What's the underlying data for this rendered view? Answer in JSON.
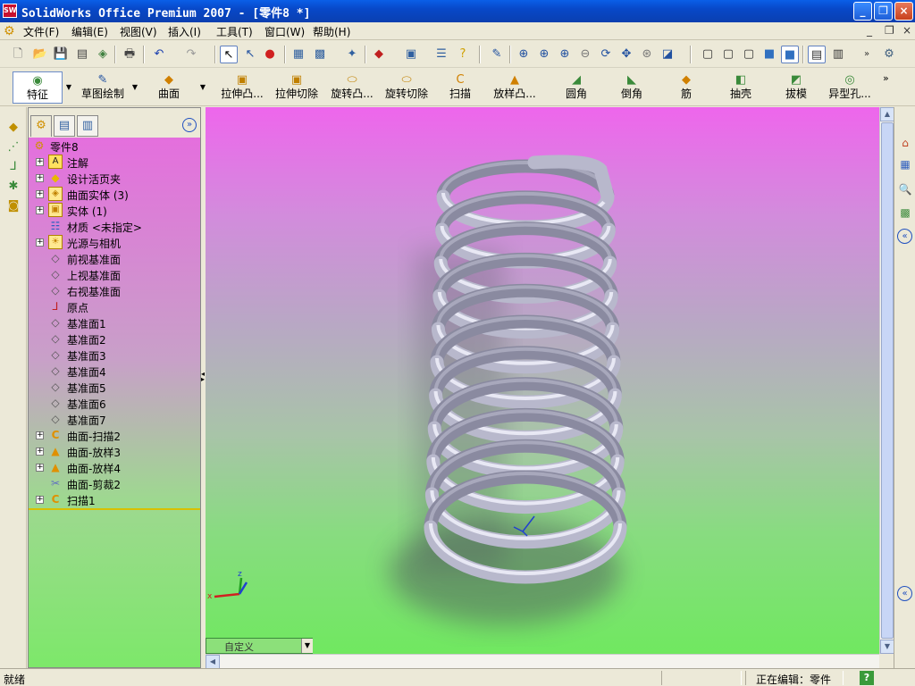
{
  "window": {
    "title": "SolidWorks Office Premium 2007 - [零件8 *]",
    "logo_text": "SW"
  },
  "menu": {
    "items": [
      "文件(F)",
      "编辑(E)",
      "视图(V)",
      "插入(I)",
      "工具(T)",
      "窗口(W)",
      "帮助(H)"
    ],
    "doc_controls": [
      "_",
      "❐",
      "×"
    ]
  },
  "feature_toolbar": {
    "buttons": [
      "特征",
      "草图绘制",
      "曲面",
      "拉伸凸...",
      "拉伸切除",
      "旋转凸...",
      "旋转切除",
      "扫描",
      "放样凸...",
      "圆角",
      "倒角",
      "筋",
      "抽壳",
      "拔模",
      "异型孔..."
    ]
  },
  "feature_tree": {
    "root": "零件8",
    "items": [
      {
        "label": "注解",
        "icon": "annotation-icon",
        "expandable": true
      },
      {
        "label": "设计活页夹",
        "icon": "design-binder-icon",
        "expandable": true
      },
      {
        "label": "曲面实体 (3)",
        "icon": "surface-bodies-icon",
        "expandable": true
      },
      {
        "label": "实体 (1)",
        "icon": "solid-bodies-icon",
        "expandable": true
      },
      {
        "label": "材质 <未指定>",
        "icon": "material-icon",
        "expandable": false
      },
      {
        "label": "光源与相机",
        "icon": "lights-cameras-icon",
        "expandable": true
      },
      {
        "label": "前视基准面",
        "icon": "plane-icon",
        "expandable": false
      },
      {
        "label": "上视基准面",
        "icon": "plane-icon",
        "expandable": false
      },
      {
        "label": "右视基准面",
        "icon": "plane-icon",
        "expandable": false
      },
      {
        "label": "原点",
        "icon": "origin-icon",
        "expandable": false
      },
      {
        "label": "基准面1",
        "icon": "plane-icon",
        "expandable": false
      },
      {
        "label": "基准面2",
        "icon": "plane-icon",
        "expandable": false
      },
      {
        "label": "基准面3",
        "icon": "plane-icon",
        "expandable": false
      },
      {
        "label": "基准面4",
        "icon": "plane-icon",
        "expandable": false
      },
      {
        "label": "基准面5",
        "icon": "plane-icon",
        "expandable": false
      },
      {
        "label": "基准面6",
        "icon": "plane-icon",
        "expandable": false
      },
      {
        "label": "基准面7",
        "icon": "plane-icon",
        "expandable": false
      },
      {
        "label": "曲面-扫描2",
        "icon": "surface-sweep-icon",
        "expandable": true
      },
      {
        "label": "曲面-放样3",
        "icon": "surface-loft-icon",
        "expandable": true
      },
      {
        "label": "曲面-放样4",
        "icon": "surface-loft-icon",
        "expandable": true
      },
      {
        "label": "曲面-剪裁2",
        "icon": "surface-trim-icon",
        "expandable": false
      },
      {
        "label": "扫描1",
        "icon": "sweep-icon",
        "expandable": true
      }
    ]
  },
  "viewport": {
    "configuration": "自定义"
  },
  "status": {
    "left": "就绪",
    "right": "正在编辑：零件",
    "help": "?"
  },
  "colors": {
    "titlebar": "#0a5fe8",
    "viewport_top": "#ee66ec",
    "viewport_bottom": "#70e860",
    "spring": "#b8b8cc"
  }
}
